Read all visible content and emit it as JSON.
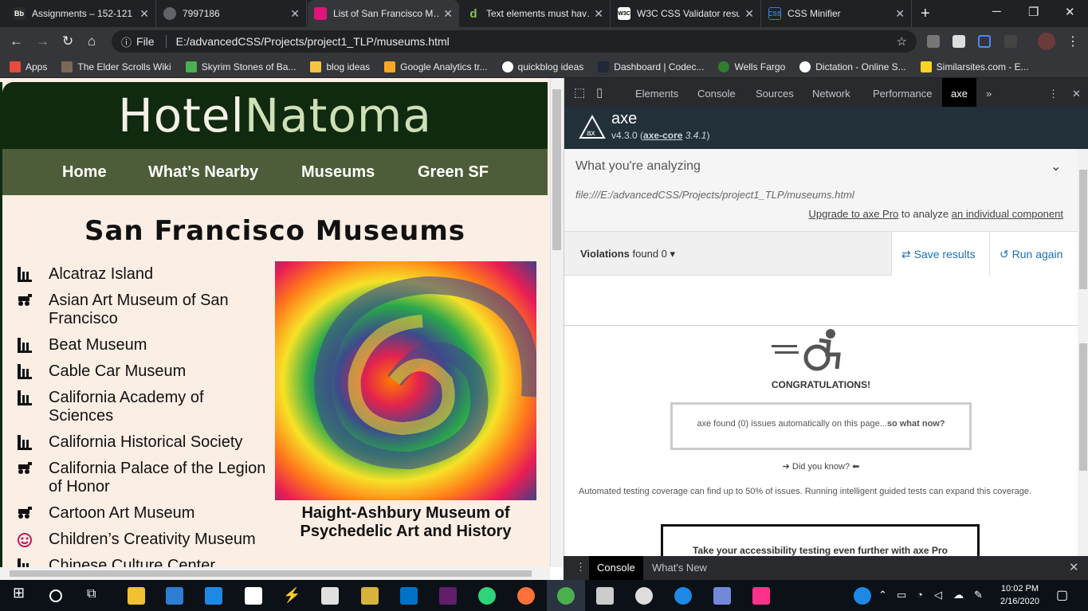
{
  "browser": {
    "tabs": [
      {
        "title": "Assignments – 152-121",
        "icon_color": "#2b2b2b",
        "icon_text": "Bb"
      },
      {
        "title": "7997186",
        "icon_color": "#5f6368",
        "icon_text": ""
      },
      {
        "title": "List of San Francisco M…",
        "icon_color": "#e0157a",
        "icon_text": ""
      },
      {
        "title": "Text elements must hav…",
        "icon_color": "#8bc34a",
        "icon_text": "d"
      },
      {
        "title": "W3C CSS Validator resu…",
        "icon_color": "#ffffff",
        "icon_text": "W3C"
      },
      {
        "title": "CSS Minifier",
        "icon_color": "#3a7bd5",
        "icon_text": "CSS"
      }
    ],
    "url_label": "File",
    "url": "E:/advancedCSS/Projects/project1_TLP/museums.html",
    "bookmarks": [
      {
        "label": "Apps",
        "color": "#e84a3c"
      },
      {
        "label": "The Elder Scrolls Wiki",
        "color": "#7a6a55"
      },
      {
        "label": "Skyrim Stones of Ba...",
        "color": "#4caf50"
      },
      {
        "label": "blog ideas",
        "color": "#f5c542"
      },
      {
        "label": "Google Analytics tr...",
        "color": "#f9a825"
      },
      {
        "label": "quickblog ideas",
        "color": "#ffffff"
      },
      {
        "label": "Dashboard | Codec...",
        "color": "#1f2937"
      },
      {
        "label": "Wells Fargo",
        "color": "#2e7d32"
      },
      {
        "label": "Dictation - Online S...",
        "color": "#ffffff"
      },
      {
        "label": "Similarsites.com - E...",
        "color": "#f9d423"
      }
    ]
  },
  "site": {
    "logo_part1": "Hotel",
    "logo_part2": "Natoma",
    "nav": [
      "Home",
      "What’s Nearby",
      "Museums",
      "Green SF"
    ],
    "heading": "San Francisco Museums",
    "museums": [
      {
        "name": "Alcatraz Island",
        "icon": "building-icon"
      },
      {
        "name": "Asian Art Museum of San Francisco",
        "icon": "cannon-icon"
      },
      {
        "name": "Beat Museum",
        "icon": "building-icon"
      },
      {
        "name": "Cable Car Museum",
        "icon": "building-icon"
      },
      {
        "name": "California Academy of Sciences",
        "icon": "building-icon"
      },
      {
        "name": "California Historical Society",
        "icon": "building-icon"
      },
      {
        "name": "California Palace of the Legion of Honor",
        "icon": "cannon-icon"
      },
      {
        "name": "Cartoon Art Museum",
        "icon": "cannon-icon"
      },
      {
        "name": "Children’s Creativity Museum",
        "icon": "smiley-icon"
      },
      {
        "name": "Chinese Culture Center",
        "icon": "building-icon"
      }
    ],
    "image_caption": "Haight-Ashbury Museum of Psychedelic Art and History"
  },
  "devtools": {
    "tabs": [
      "Elements",
      "Console",
      "Sources",
      "Network",
      "Performance",
      "axe"
    ],
    "axe_name": "axe",
    "axe_version": "v4.3.0",
    "axe_core": "axe-core",
    "axe_core_version": "3.4.1",
    "analyzing_label": "What you're analyzing",
    "analyzing_path": "file:///E:/advancedCSS/Projects/project1_TLP/museums.html",
    "upgrade_link": "Upgrade to axe Pro",
    "upgrade_rest": "to analyze",
    "upgrade_link2": "an individual component",
    "violations_label": "Violations",
    "violations_found": "found 0",
    "save_label": "Save results",
    "run_label": "Run again",
    "congrats": "CONGRATULATIONS!",
    "found_text": "axe found (0) issues automatically on this page...",
    "found_bold": "so what now?",
    "did_you_know": "Did you know?",
    "coverage": "Automated testing coverage can find up to 50% of issues. Running intelligent guided tests can expand this coverage.",
    "pro_text": "Take your accessibility testing even further with axe Pro",
    "drawer_tabs": [
      "Console",
      "What's New"
    ]
  },
  "taskbar": {
    "time": "10:02 PM",
    "date": "2/16/2020"
  }
}
